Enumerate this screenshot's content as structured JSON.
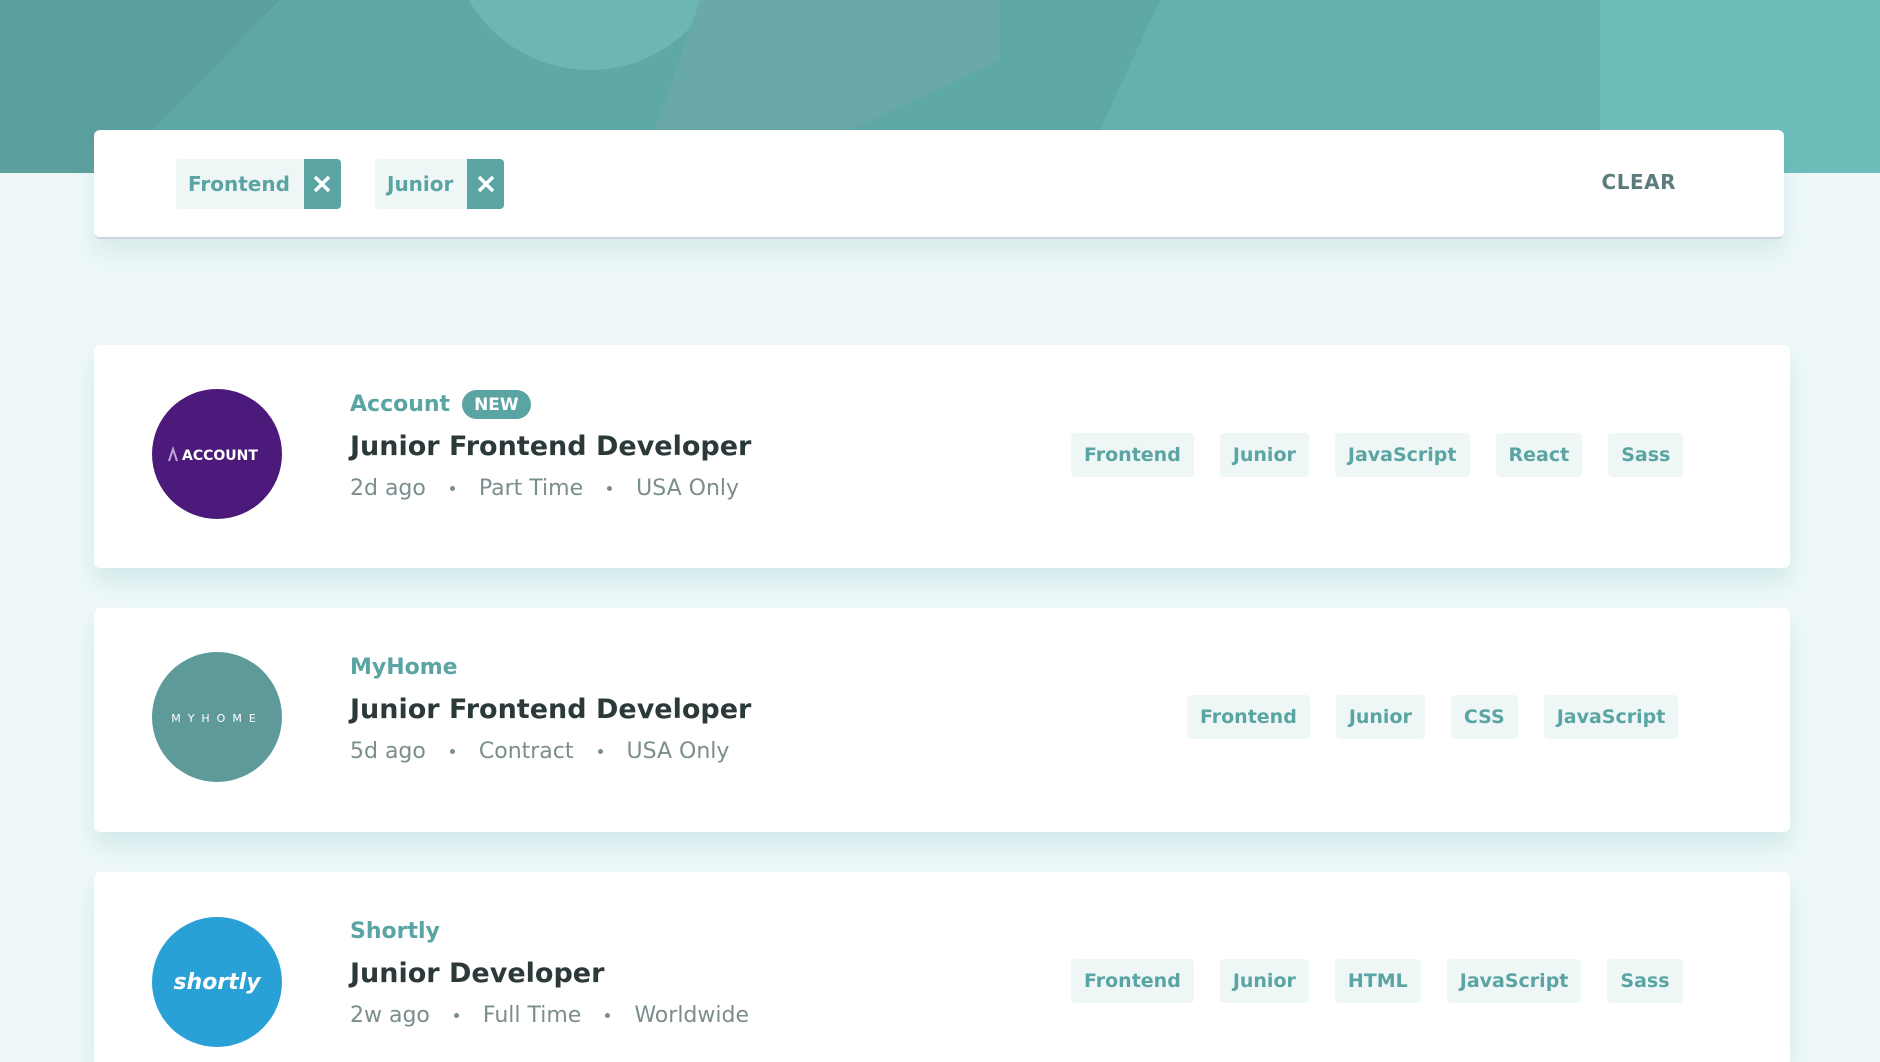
{
  "filters": {
    "chips": [
      {
        "label": "Frontend"
      },
      {
        "label": "Junior"
      }
    ],
    "clear_label": "CLEAR"
  },
  "jobs": [
    {
      "company": "Account",
      "badge": "NEW",
      "position": "Junior Frontend Developer",
      "posted": "2d ago",
      "contract": "Part Time",
      "location": "USA Only",
      "logo_text": "ACCOUNT",
      "logo_color": "#4c1a7a",
      "tags": [
        "Frontend",
        "Junior",
        "JavaScript",
        "React",
        "Sass"
      ]
    },
    {
      "company": "MyHome",
      "position": "Junior Frontend Developer",
      "posted": "5d ago",
      "contract": "Contract",
      "location": "USA Only",
      "logo_text": "MYHOME",
      "logo_color": "#5e9a9a",
      "tags": [
        "Frontend",
        "Junior",
        "CSS",
        "JavaScript"
      ]
    },
    {
      "company": "Shortly",
      "position": "Junior Developer",
      "posted": "2w ago",
      "contract": "Full Time",
      "location": "Worldwide",
      "logo_text": "shortly",
      "logo_color": "#2aa1d6",
      "tags": [
        "Frontend",
        "Junior",
        "HTML",
        "JavaScript",
        "Sass"
      ]
    }
  ],
  "colors": {
    "primary": "#5ba4a4",
    "background": "#eef8f9",
    "tag_background": "#eef6f6",
    "heading": "#2b3939",
    "meta": "#7b8e8e"
  }
}
